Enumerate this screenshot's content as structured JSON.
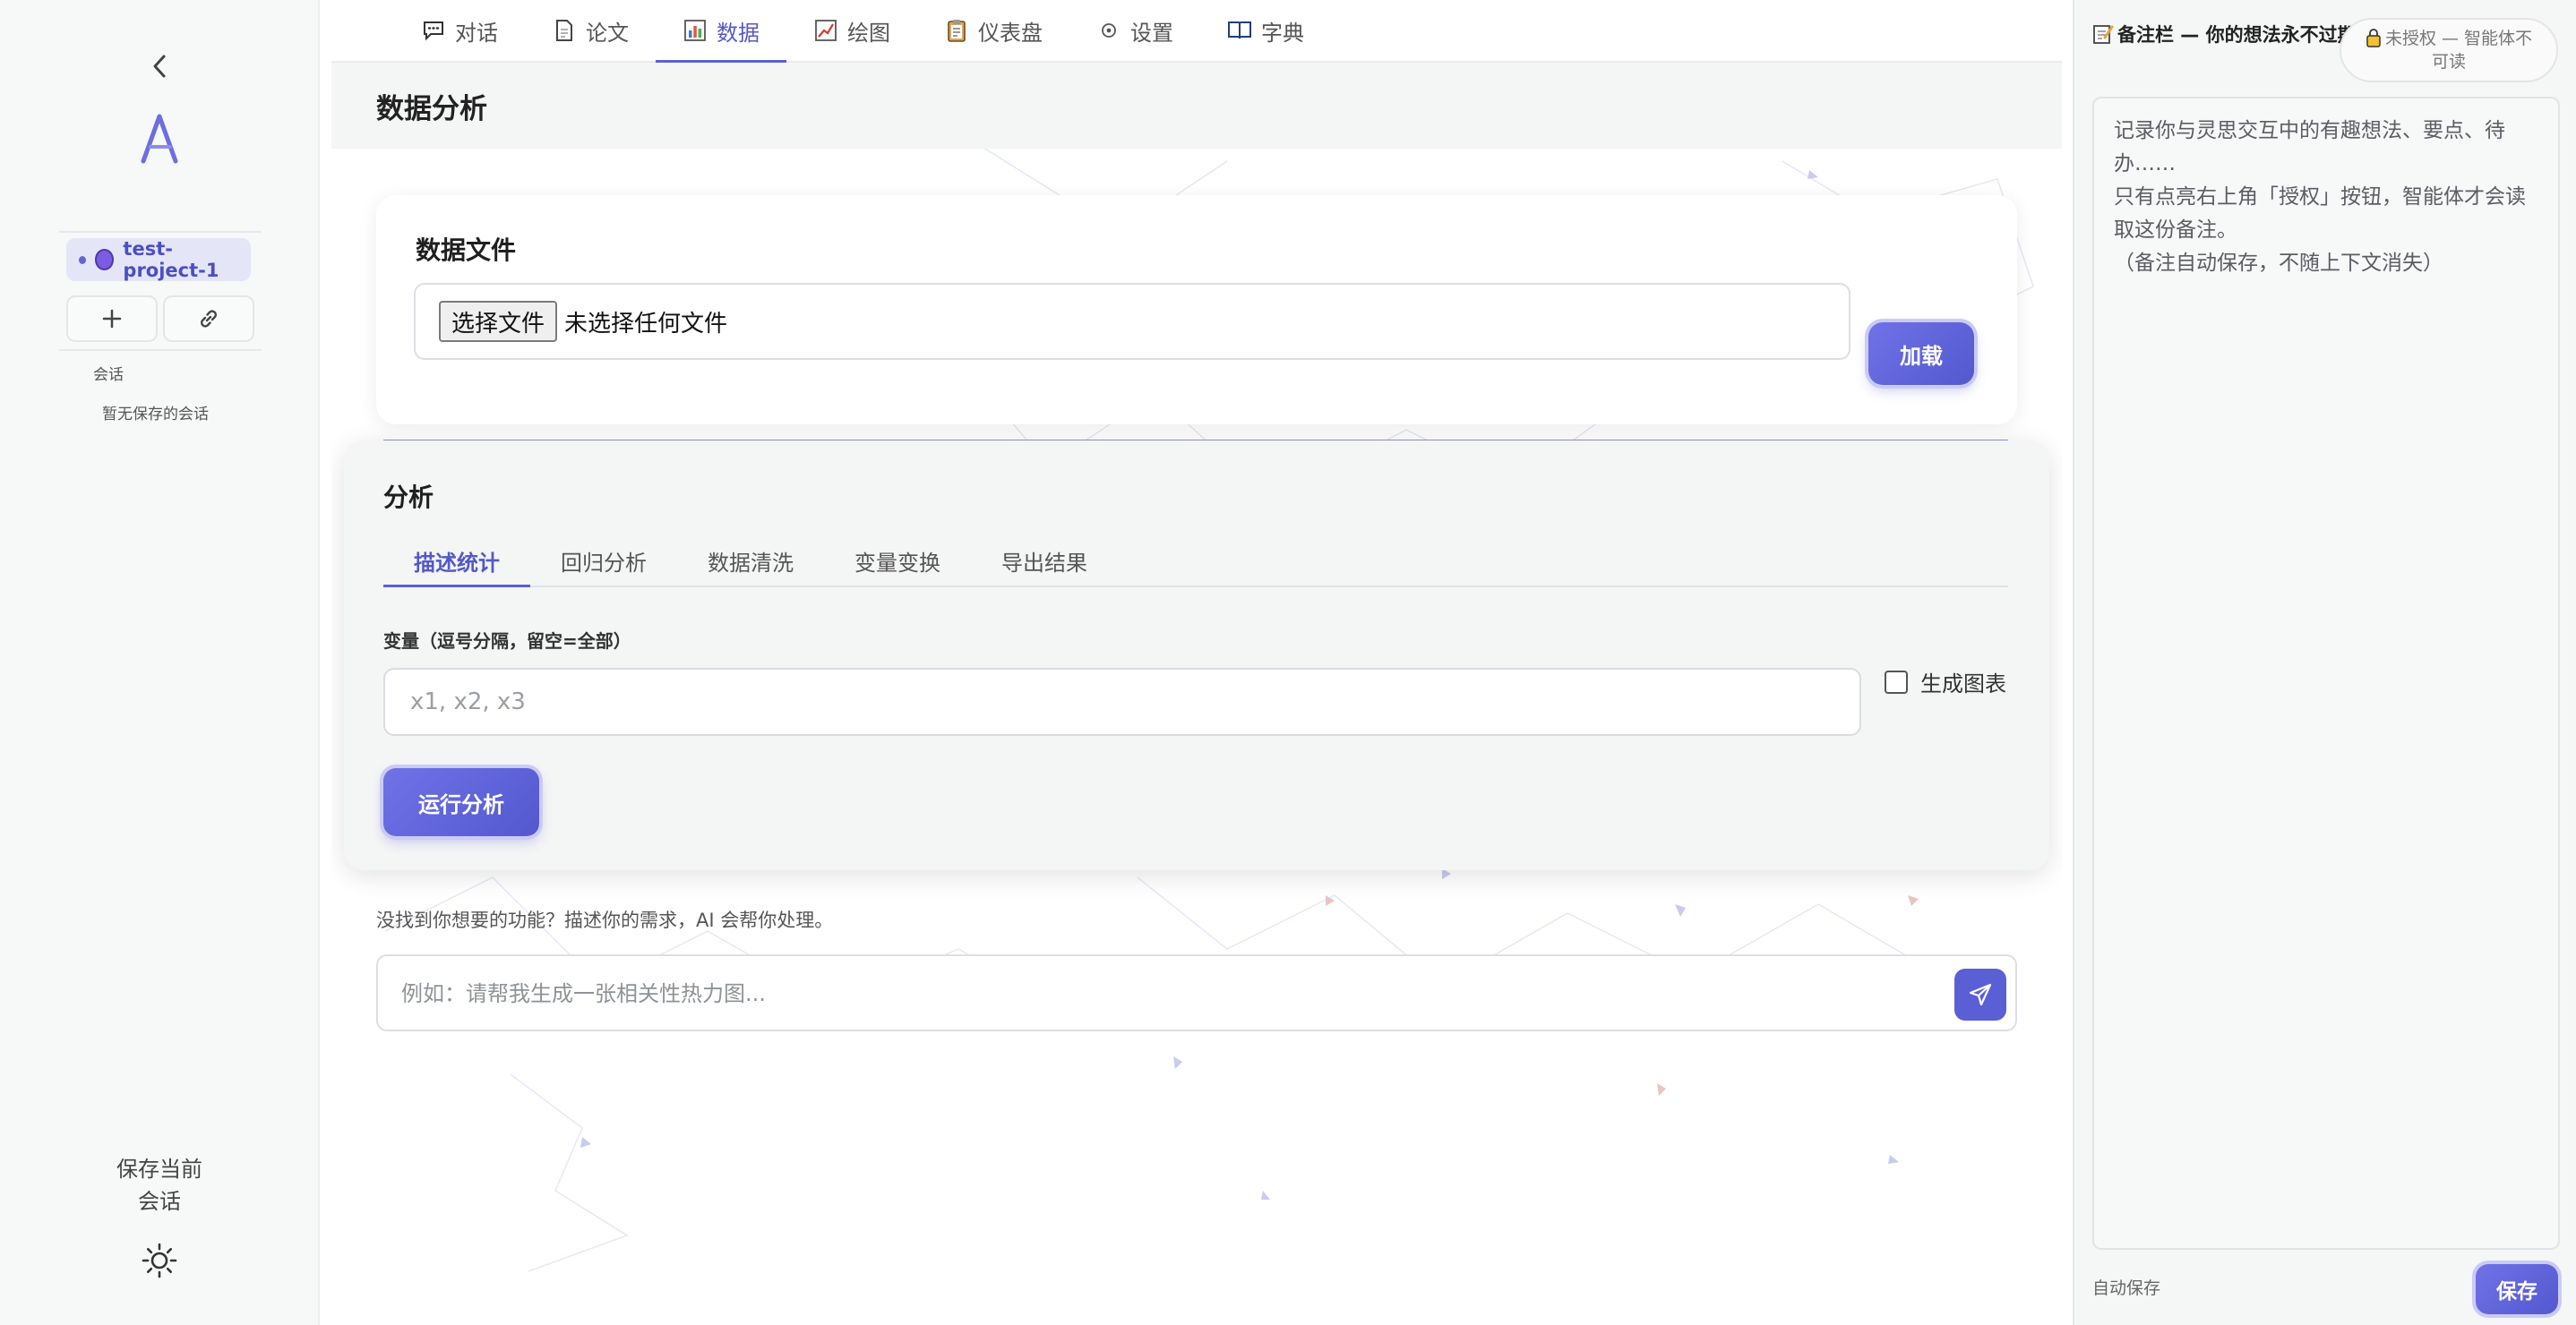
{
  "sidebar": {
    "project_name": "test-project-1",
    "section_label": "会话",
    "empty_sessions": "暂无保存的会话",
    "save_session": "保存当前会话"
  },
  "tabs": [
    {
      "label": "对话",
      "icon": "chat-icon"
    },
    {
      "label": "论文",
      "icon": "document-icon"
    },
    {
      "label": "数据",
      "icon": "bar-chart-icon",
      "active": true
    },
    {
      "label": "绘图",
      "icon": "line-chart-icon"
    },
    {
      "label": "仪表盘",
      "icon": "clipboard-icon"
    },
    {
      "label": "设置",
      "icon": "gear-icon"
    },
    {
      "label": "字典",
      "icon": "book-icon"
    }
  ],
  "page": {
    "title": "数据分析"
  },
  "file_card": {
    "title": "数据文件",
    "choose_button": "选择文件",
    "status": "未选择任何文件",
    "load_button": "加载"
  },
  "analysis": {
    "title": "分析",
    "subtabs": [
      "描述统计",
      "回归分析",
      "数据清洗",
      "变量变换",
      "导出结果"
    ],
    "active_subtab": "描述统计",
    "variables_label": "变量（逗号分隔，留空=全部）",
    "variables_placeholder": "x1, x2, x3",
    "variables_value": "",
    "chart_checkbox_label": "生成图表",
    "chart_checked": false,
    "run_button": "运行分析"
  },
  "ai": {
    "hint": "没找到你想要的功能？描述你的需求，AI 会帮你处理。",
    "placeholder": "例如：请帮我生成一张相关性热力图...",
    "value": ""
  },
  "notes": {
    "title": "备注栏 — 你的想法永不过期",
    "auth_status": "未授权 — 智能体不可读",
    "placeholder": "记录你与灵思交互中的有趣想法、要点、待办……\n只有点亮右上角「授权」按钮，智能体才会读取这份备注。\n（备注自动保存，不随上下文消失）",
    "value": "",
    "autosave_label": "自动保存",
    "save_button": "保存"
  },
  "colors": {
    "accent": "#5b5fd6",
    "accent_light": "#e5e5f8",
    "sidebar_bg": "#f7f8f8"
  }
}
